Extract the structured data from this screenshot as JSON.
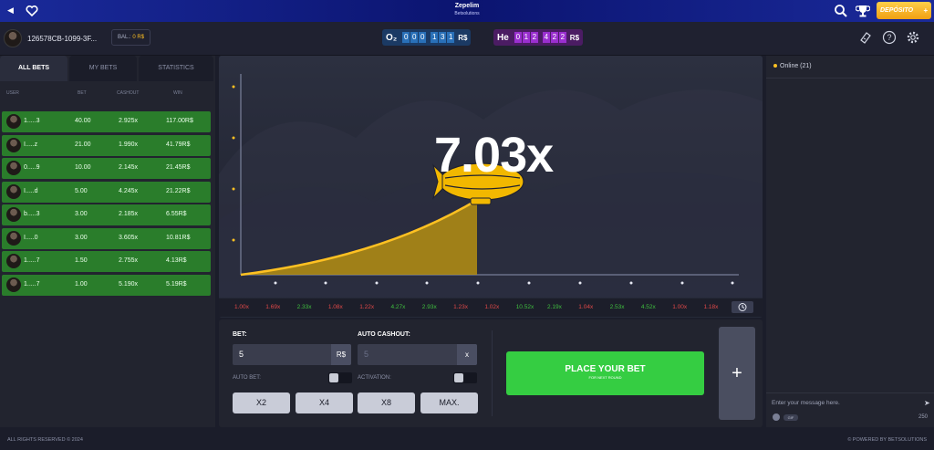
{
  "header": {
    "title": "Zepelim",
    "subtitle": "Betsolutions",
    "deposit_label": "DEPÓSITO",
    "deposit_plus": "+"
  },
  "info": {
    "username": "126578CB-1099-3F...",
    "balance_label": "BAL.:",
    "balance_value": "0 R$",
    "o2": {
      "label": "O₂",
      "digits": [
        "0",
        "0",
        "0",
        "1",
        "3",
        "1"
      ],
      "currency": "R$"
    },
    "he": {
      "label": "He",
      "digits": [
        "0",
        "1",
        "2",
        "4",
        "2",
        "2"
      ],
      "currency": "R$"
    }
  },
  "bets": {
    "tabs": [
      "ALL BETS",
      "MY BETS",
      "STATISTICS"
    ],
    "active_tab": 0,
    "columns": [
      "USER",
      "BET",
      "CASHOUT",
      "WIN"
    ],
    "rows": [
      {
        "user": "1.....3",
        "bet": "40.00",
        "cashout": "2.925x",
        "win": "117.00R$"
      },
      {
        "user": "I.....z",
        "bet": "21.00",
        "cashout": "1.990x",
        "win": "41.79R$"
      },
      {
        "user": "0.....9",
        "bet": "10.00",
        "cashout": "2.145x",
        "win": "21.45R$"
      },
      {
        "user": "I.....d",
        "bet": "5.00",
        "cashout": "4.245x",
        "win": "21.22R$"
      },
      {
        "user": "b.....3",
        "bet": "3.00",
        "cashout": "2.185x",
        "win": "6.55R$"
      },
      {
        "user": "I.....0",
        "bet": "3.00",
        "cashout": "3.605x",
        "win": "10.81R$"
      },
      {
        "user": "1.....7",
        "bet": "1.50",
        "cashout": "2.755x",
        "win": "4.13R$"
      },
      {
        "user": "1.....7",
        "bet": "1.00",
        "cashout": "5.190x",
        "win": "5.19R$"
      }
    ]
  },
  "game": {
    "multiplier": "7.03x",
    "history": [
      {
        "v": "1.00x",
        "c": "r"
      },
      {
        "v": "1.69x",
        "c": "r"
      },
      {
        "v": "2.33x",
        "c": "g"
      },
      {
        "v": "1.08x",
        "c": "r"
      },
      {
        "v": "1.22x",
        "c": "r"
      },
      {
        "v": "4.27x",
        "c": "g"
      },
      {
        "v": "2.93x",
        "c": "g"
      },
      {
        "v": "1.23x",
        "c": "r"
      },
      {
        "v": "1.02x",
        "c": "r"
      },
      {
        "v": "10.52x",
        "c": "g"
      },
      {
        "v": "2.19x",
        "c": "g"
      },
      {
        "v": "1.04x",
        "c": "r"
      },
      {
        "v": "2.53x",
        "c": "g"
      },
      {
        "v": "4.52x",
        "c": "g"
      },
      {
        "v": "1.00x",
        "c": "r"
      },
      {
        "v": "1.18x",
        "c": "r"
      }
    ]
  },
  "betform": {
    "bet_label": "BET:",
    "bet_value": "5",
    "bet_currency": "R$",
    "auto_cashout_label": "AUTO CASHOUT:",
    "auto_cashout_value": "5",
    "auto_cashout_suffix": "x",
    "auto_bet_label": "AUTO BET:",
    "activation_label": "ACTIVATION:",
    "quick": [
      "X2",
      "X4",
      "X8",
      "MAX."
    ],
    "place_label": "PLACE YOUR BET",
    "place_sub": "FOR NEXT ROUND",
    "add_label": "+"
  },
  "chat": {
    "online": "Online (21)",
    "placeholder": "Enter your message here.",
    "gif": "GIF",
    "count": "250"
  },
  "footer": {
    "left": "ALL RIGHTS RESERVED © 2024",
    "right": "© POWERED BY BETSOLUTIONS"
  },
  "colors": {
    "win_row": "#2a7d2b",
    "place_bet": "#35cd42",
    "accent": "#ffc122",
    "loss": "#e04848",
    "gain": "#3fbf3f"
  }
}
